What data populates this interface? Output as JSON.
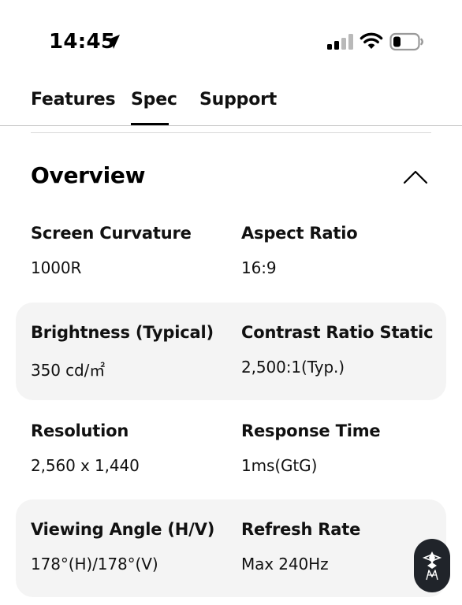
{
  "status_bar": {
    "time": "14:45",
    "location_icon": "location-arrow-icon",
    "signal_icon": "cellular-signal-icon",
    "wifi_icon": "wifi-icon",
    "battery_icon": "battery-icon",
    "battery_level": 0.3
  },
  "tabs": [
    {
      "label": "Features",
      "active": false
    },
    {
      "label": "Spec",
      "active": true
    },
    {
      "label": "Support",
      "active": false
    }
  ],
  "section": {
    "title": "Overview",
    "toggle_icon": "chevron-up-icon",
    "expanded": true
  },
  "specs": [
    {
      "shaded": false,
      "left": {
        "label": "Screen Curvature",
        "value": "1000R"
      },
      "right": {
        "label": "Aspect Ratio",
        "value": "16:9"
      }
    },
    {
      "shaded": true,
      "left": {
        "label": "Brightness (Typical)",
        "value": "350 cd/㎡"
      },
      "right": {
        "label": "Contrast Ratio Static",
        "value": "2,500:1(Typ.)"
      }
    },
    {
      "shaded": false,
      "left": {
        "label": "Resolution",
        "value": "2,560 x 1,440"
      },
      "right": {
        "label": "Response Time",
        "value": "1ms(GtG)"
      }
    },
    {
      "shaded": true,
      "left": {
        "label": "Viewing Angle (H/V)",
        "value": "178°(H)/178°(V)"
      },
      "right": {
        "label": "Refresh Rate",
        "value": "Max 240Hz"
      }
    }
  ],
  "floating_button": {
    "icon": "assistant-logo-icon"
  },
  "colors": {
    "text": "#111111",
    "shaded_row": "#f4f4f4",
    "tab_underline": "#000000",
    "floating_button_bg": "#20242a"
  }
}
